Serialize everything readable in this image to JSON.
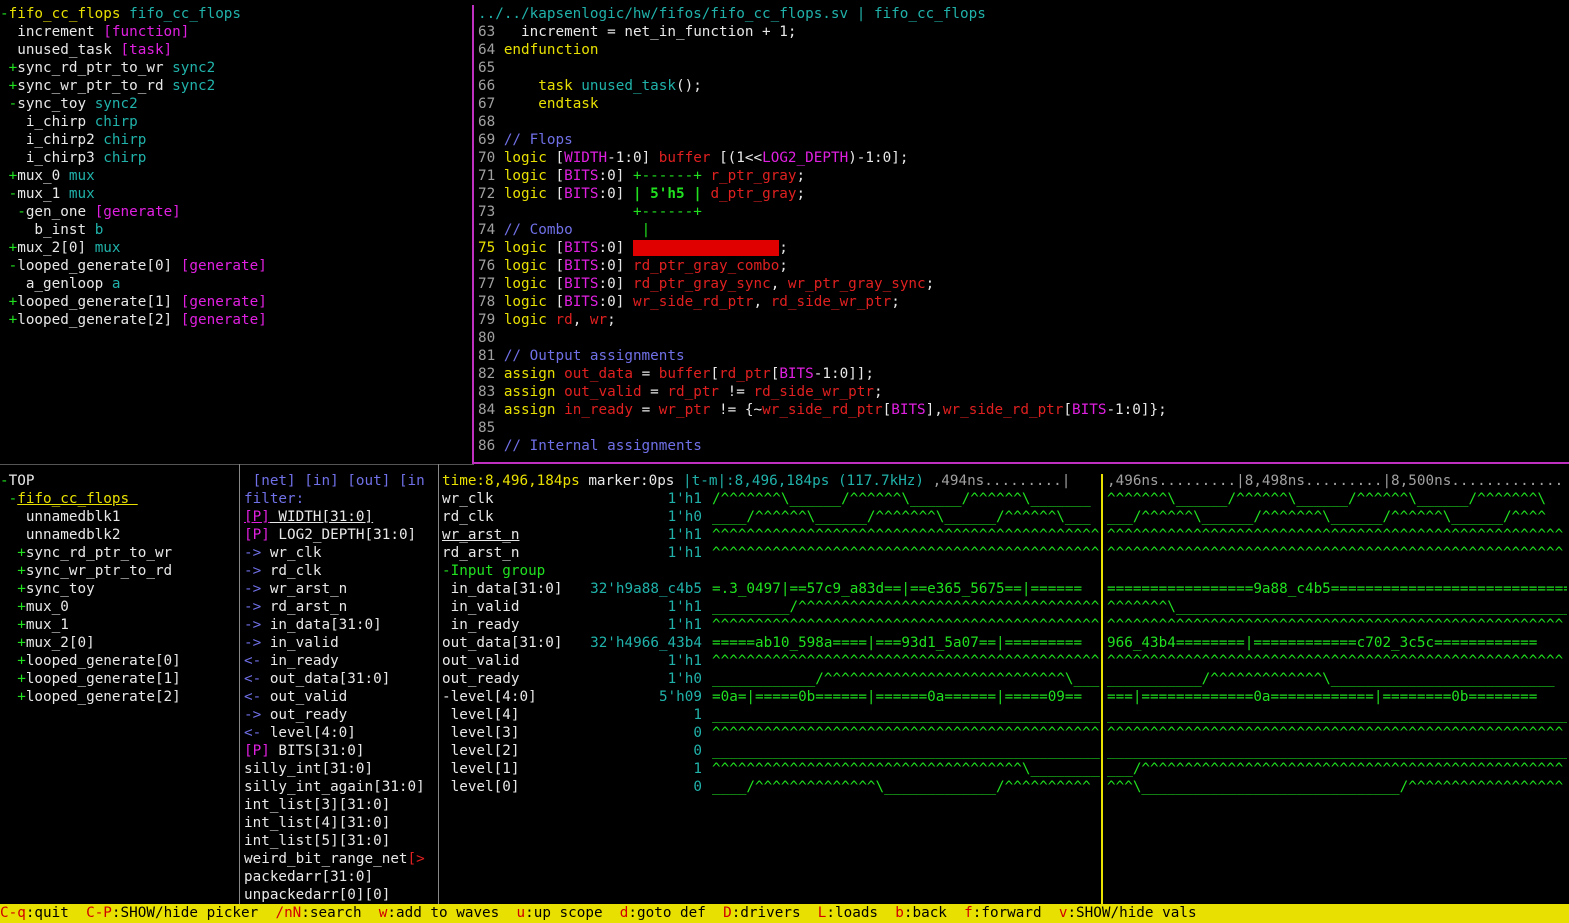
{
  "hierarchy": [
    [
      [
        "-",
        "g"
      ],
      [
        "fifo_cc_flops ",
        "y"
      ],
      [
        "fifo_cc_flops",
        "c"
      ]
    ],
    [
      [
        "  increment ",
        "w"
      ],
      [
        "[function]",
        "m"
      ]
    ],
    [
      [
        "  unused_task ",
        "w"
      ],
      [
        "[task]",
        "m"
      ]
    ],
    [
      [
        " +",
        "g"
      ],
      [
        "sync_rd_ptr_to_wr ",
        "w"
      ],
      [
        "sync2",
        "c"
      ]
    ],
    [
      [
        " +",
        "g"
      ],
      [
        "sync_wr_ptr_to_rd ",
        "w"
      ],
      [
        "sync2",
        "c"
      ]
    ],
    [
      [
        " -",
        "g"
      ],
      [
        "sync_toy ",
        "w"
      ],
      [
        "sync2",
        "c"
      ]
    ],
    [
      [
        "   i_chirp ",
        "w"
      ],
      [
        "chirp",
        "c"
      ]
    ],
    [
      [
        "   i_chirp2 ",
        "w"
      ],
      [
        "chirp",
        "c"
      ]
    ],
    [
      [
        "   i_chirp3 ",
        "w"
      ],
      [
        "chirp",
        "c"
      ]
    ],
    [
      [
        " +",
        "g"
      ],
      [
        "mux_0 ",
        "w"
      ],
      [
        "mux",
        "c"
      ]
    ],
    [
      [
        " -",
        "g"
      ],
      [
        "mux_1 ",
        "w"
      ],
      [
        "mux",
        "c"
      ]
    ],
    [
      [
        "  -",
        "g"
      ],
      [
        "gen_one ",
        "w"
      ],
      [
        "[generate]",
        "m"
      ]
    ],
    [
      [
        "    b_inst ",
        "w"
      ],
      [
        "b",
        "c"
      ]
    ],
    [
      [
        " +",
        "g"
      ],
      [
        "mux_2[0] ",
        "w"
      ],
      [
        "mux",
        "c"
      ]
    ],
    [
      [
        " -",
        "g"
      ],
      [
        "looped_generate[0] ",
        "w"
      ],
      [
        "[generate]",
        "m"
      ]
    ],
    [
      [
        "   a_genloop ",
        "w"
      ],
      [
        "a",
        "c"
      ]
    ],
    [
      [
        " +",
        "g"
      ],
      [
        "looped_generate[1] ",
        "w"
      ],
      [
        "[generate]",
        "m"
      ]
    ],
    [
      [
        " +",
        "g"
      ],
      [
        "looped_generate[2] ",
        "w"
      ],
      [
        "[generate]",
        "m"
      ]
    ]
  ],
  "code_header": "../../kapsenlogic/hw/fifos/fifo_cc_flops.sv | fifo_cc_flops",
  "code": [
    [
      [
        "63 ",
        "gr"
      ],
      [
        "  increment = net_in_function + 1;",
        "w"
      ]
    ],
    [
      [
        "64 ",
        "gr"
      ],
      [
        "endfunction",
        "y"
      ]
    ],
    [
      [
        "65 ",
        "gr"
      ]
    ],
    [
      [
        "66 ",
        "gr"
      ],
      [
        "    task ",
        "y"
      ],
      [
        "unused_task",
        "c"
      ],
      [
        "();",
        "w"
      ]
    ],
    [
      [
        "67 ",
        "gr"
      ],
      [
        "    endtask",
        "y"
      ]
    ],
    [
      [
        "68 ",
        "gr"
      ]
    ],
    [
      [
        "69 ",
        "gr"
      ],
      [
        "// Flops",
        "b"
      ]
    ],
    [
      [
        "70 ",
        "gr"
      ],
      [
        "logic ",
        "y"
      ],
      [
        "[",
        "w"
      ],
      [
        "WIDTH",
        "m"
      ],
      [
        "-1:0] ",
        "w"
      ],
      [
        "buffer ",
        "r"
      ],
      [
        "[(1<<",
        "w"
      ],
      [
        "LOG2_DEPTH",
        "m"
      ],
      [
        ")-1:0];",
        "w"
      ]
    ],
    [
      [
        "71 ",
        "gr"
      ],
      [
        "logic ",
        "y"
      ],
      [
        "[",
        "w"
      ],
      [
        "BITS",
        "m"
      ],
      [
        ":0] ",
        "w"
      ],
      [
        "+------+ ",
        "g"
      ],
      [
        "r_ptr_gray",
        "r"
      ],
      [
        ";",
        "w"
      ]
    ],
    [
      [
        "72 ",
        "gr"
      ],
      [
        "logic ",
        "y"
      ],
      [
        "[",
        "w"
      ],
      [
        "BITS",
        "m"
      ],
      [
        ":0] ",
        "w"
      ],
      [
        "| 5'h5 | ",
        "g bold"
      ],
      [
        "d_ptr_gray",
        "r"
      ],
      [
        ";",
        "w"
      ]
    ],
    [
      [
        "73 ",
        "gr"
      ],
      [
        "               ",
        "w"
      ],
      [
        "+------+",
        "g"
      ]
    ],
    [
      [
        "74 ",
        "gr"
      ],
      [
        "// Combo        ",
        "b"
      ],
      [
        "|",
        "g"
      ]
    ],
    [
      [
        "75 ",
        "y"
      ],
      [
        "logic ",
        "y"
      ],
      [
        "[",
        "w"
      ],
      [
        "BITS",
        "m"
      ],
      [
        ":0] ",
        "w"
      ],
      [
        "wr_ptr_gray_combo",
        "rbg"
      ],
      [
        ";",
        "w"
      ]
    ],
    [
      [
        "76 ",
        "gr"
      ],
      [
        "logic ",
        "y"
      ],
      [
        "[",
        "w"
      ],
      [
        "BITS",
        "m"
      ],
      [
        ":0] ",
        "w"
      ],
      [
        "rd_ptr_gray_combo",
        "r"
      ],
      [
        ";",
        "w"
      ]
    ],
    [
      [
        "77 ",
        "gr"
      ],
      [
        "logic ",
        "y"
      ],
      [
        "[",
        "w"
      ],
      [
        "BITS",
        "m"
      ],
      [
        ":0] ",
        "w"
      ],
      [
        "rd_ptr_gray_sync",
        "r"
      ],
      [
        ", ",
        "w"
      ],
      [
        "wr_ptr_gray_sync",
        "r"
      ],
      [
        ";",
        "w"
      ]
    ],
    [
      [
        "78 ",
        "gr"
      ],
      [
        "logic ",
        "y"
      ],
      [
        "[",
        "w"
      ],
      [
        "BITS",
        "m"
      ],
      [
        ":0] ",
        "w"
      ],
      [
        "wr_side_rd_ptr",
        "r"
      ],
      [
        ", ",
        "w"
      ],
      [
        "rd_side_wr_ptr",
        "r"
      ],
      [
        ";",
        "w"
      ]
    ],
    [
      [
        "79 ",
        "gr"
      ],
      [
        "logic ",
        "y"
      ],
      [
        "rd",
        "r"
      ],
      [
        ", ",
        "w"
      ],
      [
        "wr",
        "r"
      ],
      [
        ";",
        "w"
      ]
    ],
    [
      [
        "80 ",
        "gr"
      ]
    ],
    [
      [
        "81 ",
        "gr"
      ],
      [
        "// Output assignments",
        "b"
      ]
    ],
    [
      [
        "82 ",
        "gr"
      ],
      [
        "assign ",
        "y"
      ],
      [
        "out_data",
        "r"
      ],
      [
        " = ",
        "w"
      ],
      [
        "buffer",
        "r"
      ],
      [
        "[",
        "w"
      ],
      [
        "rd_ptr",
        "r"
      ],
      [
        "[",
        "w"
      ],
      [
        "BITS",
        "m"
      ],
      [
        "-1:0]];",
        "w"
      ]
    ],
    [
      [
        "83 ",
        "gr"
      ],
      [
        "assign ",
        "y"
      ],
      [
        "out_valid",
        "r"
      ],
      [
        " = ",
        "w"
      ],
      [
        "rd_ptr",
        "r"
      ],
      [
        " != ",
        "w"
      ],
      [
        "rd_side_wr_ptr",
        "r"
      ],
      [
        ";",
        "w"
      ]
    ],
    [
      [
        "84 ",
        "gr"
      ],
      [
        "assign ",
        "y"
      ],
      [
        "in_ready",
        "r"
      ],
      [
        " = ",
        "w"
      ],
      [
        "wr_ptr",
        "r"
      ],
      [
        " != {~",
        "w"
      ],
      [
        "wr_side_rd_ptr",
        "r"
      ],
      [
        "[",
        "w"
      ],
      [
        "BITS",
        "m"
      ],
      [
        "],",
        "w"
      ],
      [
        "wr_side_rd_ptr",
        "r"
      ],
      [
        "[",
        "w"
      ],
      [
        "BITS",
        "m"
      ],
      [
        "-1:0]};",
        "w"
      ]
    ],
    [
      [
        "85 ",
        "gr"
      ]
    ],
    [
      [
        "86 ",
        "gr"
      ],
      [
        "// Internal assignments",
        "b"
      ]
    ]
  ],
  "scope_tree": [
    [
      [
        "-",
        "g"
      ],
      [
        "TOP",
        "w"
      ]
    ],
    [
      [
        " -",
        "g"
      ],
      [
        "fifo_cc_flops ",
        "y u"
      ]
    ],
    [
      [
        "   unnamedblk1",
        "w"
      ]
    ],
    [
      [
        "   unnamedblk2",
        "w"
      ]
    ],
    [
      [
        "  +",
        "g"
      ],
      [
        "sync_rd_ptr_to_wr",
        "w"
      ]
    ],
    [
      [
        "  +",
        "g"
      ],
      [
        "sync_wr_ptr_to_rd",
        "w"
      ]
    ],
    [
      [
        "  +",
        "g"
      ],
      [
        "sync_toy",
        "w"
      ]
    ],
    [
      [
        "  +",
        "g"
      ],
      [
        "mux_0",
        "w"
      ]
    ],
    [
      [
        "  +",
        "g"
      ],
      [
        "mux_1",
        "w"
      ]
    ],
    [
      [
        "  +",
        "g"
      ],
      [
        "mux_2[0]",
        "w"
      ]
    ],
    [
      [
        "  +",
        "g"
      ],
      [
        "looped_generate[0]",
        "w"
      ]
    ],
    [
      [
        "  +",
        "g"
      ],
      [
        "looped_generate[1]",
        "w"
      ]
    ],
    [
      [
        "  +",
        "g"
      ],
      [
        "looped_generate[2]",
        "w"
      ]
    ]
  ],
  "signal_list": [
    [
      [
        " [net] [in] [out] [in",
        "b"
      ]
    ],
    [
      [
        "filter:",
        "b"
      ]
    ],
    [
      [
        "[P]",
        "m u"
      ],
      [
        " WIDTH[31:0]",
        "w u"
      ]
    ],
    [
      [
        "[P]",
        "m"
      ],
      [
        " LOG2_DEPTH[31:0]",
        "w"
      ]
    ],
    [
      [
        "->",
        "b"
      ],
      [
        " wr_clk",
        "w"
      ]
    ],
    [
      [
        "->",
        "b"
      ],
      [
        " rd_clk",
        "w"
      ]
    ],
    [
      [
        "->",
        "b"
      ],
      [
        " wr_arst_n",
        "w"
      ]
    ],
    [
      [
        "->",
        "b"
      ],
      [
        " rd_arst_n",
        "w"
      ]
    ],
    [
      [
        "->",
        "b"
      ],
      [
        " in_data[31:0]",
        "w"
      ]
    ],
    [
      [
        "->",
        "b"
      ],
      [
        " in_valid",
        "w"
      ]
    ],
    [
      [
        "<-",
        "b"
      ],
      [
        " in_ready",
        "w"
      ]
    ],
    [
      [
        "<-",
        "b"
      ],
      [
        " out_data[31:0]",
        "w"
      ]
    ],
    [
      [
        "<-",
        "b"
      ],
      [
        " out_valid",
        "w"
      ]
    ],
    [
      [
        "->",
        "b"
      ],
      [
        " out_ready",
        "w"
      ]
    ],
    [
      [
        "<-",
        "b"
      ],
      [
        " level[4:0]",
        "w"
      ]
    ],
    [
      [
        "[P]",
        "m"
      ],
      [
        " BITS[31:0]",
        "w"
      ]
    ],
    [
      [
        "silly_int[31:0]",
        "w"
      ]
    ],
    [
      [
        "silly_int_again[31:0]",
        "w"
      ]
    ],
    [
      [
        "int_list[3][31:0]",
        "w"
      ]
    ],
    [
      [
        "int_list[4][31:0]",
        "w"
      ]
    ],
    [
      [
        "int_list[5][31:0]",
        "w"
      ]
    ],
    [
      [
        "weird_bit_range_net",
        "w"
      ],
      [
        "[>",
        "r"
      ]
    ],
    [
      [
        "packedarr[31:0]",
        "w"
      ]
    ],
    [
      [
        "unpackedarr[0][0]",
        "w"
      ]
    ]
  ],
  "wave_header": [
    [
      "time:8,496,184ps ",
      "y"
    ],
    [
      "marker:0ps ",
      "w"
    ],
    [
      "|t-m|:8,496,184ps (117.7kHz) ",
      "c"
    ],
    [
      ",494ns.........|",
      "gr"
    ]
  ],
  "wave_header_right": [
    [
      ",496ns.........|8,498ns.........|8,500ns.............",
      "gr"
    ]
  ],
  "waves": [
    {
      "name": "wr_clk",
      "val": "1'h1",
      "l": "/^^^^^^^\\______/^^^^^^\\______/^^^^^^\\_______",
      "r": "^^^^^^^\\______/^^^^^^\\______/^^^^^^\\______/^^^^^^^\\"
    },
    {
      "name": "rd_clk",
      "val": "1'h0",
      "l": "____/^^^^^^\\______/^^^^^^^\\______/^^^^^^\\___",
      "r": "___/^^^^^^\\______/^^^^^^^\\______/^^^^^^\\______/^^^^"
    },
    {
      "name": "wr_arst_n",
      "val": "1'h1",
      "u": true,
      "l": "^^^^^^^^^^^^^^^^^^^^^^^^^^^^^^^^^^^^^^^^^^^^^^",
      "r": "^^^^^^^^^^^^^^^^^^^^^^^^^^^^^^^^^^^^^^^^^^^^^^^^^^^^^"
    },
    {
      "name": "rd_arst_n",
      "val": "1'h1",
      "l": "^^^^^^^^^^^^^^^^^^^^^^^^^^^^^^^^^^^^^^^^^^^^^^",
      "r": "^^^^^^^^^^^^^^^^^^^^^^^^^^^^^^^^^^^^^^^^^^^^^^^^^^^^^"
    },
    {
      "name": "-Input group",
      "val": "",
      "grp": true,
      "l": "",
      "r": ""
    },
    {
      "name": " in_data[31:0]",
      "val": "32'h9a88_c4b5",
      "l": "=.3_0497|==57c9_a83d==|==e365_5675==|======",
      "r": "=================9a88_c4b5============================"
    },
    {
      "name": " in_valid",
      "val": "1'h1",
      "l": "_________/^^^^^^^^^^^^^^^^^^^^^^^^^^^^^^^^^^^^",
      "r": "^^^^^^^\\______________________________________________"
    },
    {
      "name": " in_ready",
      "val": "1'h1",
      "l": "^^^^^^^^^^^^^^^^^^^^^^^^^^^^^^^^^^^^^^^^^^^^^^",
      "r": "^^^^^^^^^^^^^^^^^^^^^^^^^^^^^^^^^^^^^^^^^^^^^^^^^^^^^"
    },
    {
      "name": "out_data[31:0]",
      "val": "32'h4966_43b4",
      "l": "=====ab10_598a====|===93d1_5a07==|=========",
      "r": "966_43b4========|============c702_3c5c============"
    },
    {
      "name": "out_valid",
      "val": "1'h1",
      "l": "^^^^^^^^^^^^^^^^^^^^^^^^^^^^^^^^^^^^^^^^^^^^^^",
      "r": "^^^^^^^^^^^^^^^^^^^^^^^^^^^^^^^^^^^^^^^^^^^^^^^^^^^^^"
    },
    {
      "name": "out_ready",
      "val": "1'h0",
      "l": "____________/^^^^^^^^^^^^^^^^^^^^^^^^^^^^\\___",
      "r": "___________/^^^^^^^^^^^^^\\__________________________"
    },
    {
      "name": "-level[4:0]",
      "val": "5'h09",
      "l": "=0a=|=====0b======|======0a======|=====09==",
      "r": "===|=============0a============|========0b========"
    },
    {
      "name": " level[4]",
      "val": "1",
      "l": "______________________________________________",
      "r": "______________________________________________________"
    },
    {
      "name": " level[3]",
      "val": "0",
      "l": "^^^^^^^^^^^^^^^^^^^^^^^^^^^^^^^^^^^^^^^^^^^^^^",
      "r": "^^^^^^^^^^^^^^^^^^^^^^^^^^^^^^^^^^^^^^^^^^^^^^^^^^^^^"
    },
    {
      "name": " level[2]",
      "val": "0",
      "l": "______________________________________________",
      "r": "______________________________________________________"
    },
    {
      "name": " level[1]",
      "val": "1",
      "l": "^^^^^^^^^^^^^^^^^^^^^^^^^^^^^^^^^^^^\\_________",
      "r": "___/^^^^^^^^^^^^^^^^^^^^^^^^^^^^^^^^^^^^^^^^^^^^^^^^^"
    },
    {
      "name": " level[0]",
      "val": "0",
      "l": "____/^^^^^^^^^^^^^^\\_____________/^^^^^^^^^^",
      "r": "^^^\\______________________________/^^^^^^^^^^^^^^^^^^"
    }
  ],
  "status": [
    [
      "C-q",
      "k"
    ],
    [
      ":quit  ",
      ""
    ],
    [
      "C-P",
      "k"
    ],
    [
      ":SHOW/hide picker  ",
      ""
    ],
    [
      "/nN",
      "k"
    ],
    [
      ":search  ",
      ""
    ],
    [
      "w",
      "k"
    ],
    [
      ":add to waves  ",
      ""
    ],
    [
      "u",
      "k"
    ],
    [
      ":up scope  ",
      ""
    ],
    [
      "d",
      "k"
    ],
    [
      ":goto def  ",
      ""
    ],
    [
      "D",
      "k"
    ],
    [
      ":drivers  ",
      ""
    ],
    [
      "L",
      "k"
    ],
    [
      ":loads  ",
      ""
    ],
    [
      "b",
      "k"
    ],
    [
      ":back  ",
      ""
    ],
    [
      "f",
      "k"
    ],
    [
      ":forward  ",
      ""
    ],
    [
      "v",
      "k"
    ],
    [
      ":SHOW/hide vals",
      ""
    ]
  ],
  "colors": {
    "background": "#000000",
    "accent": "#e8e000",
    "separator": "#c030c0"
  }
}
